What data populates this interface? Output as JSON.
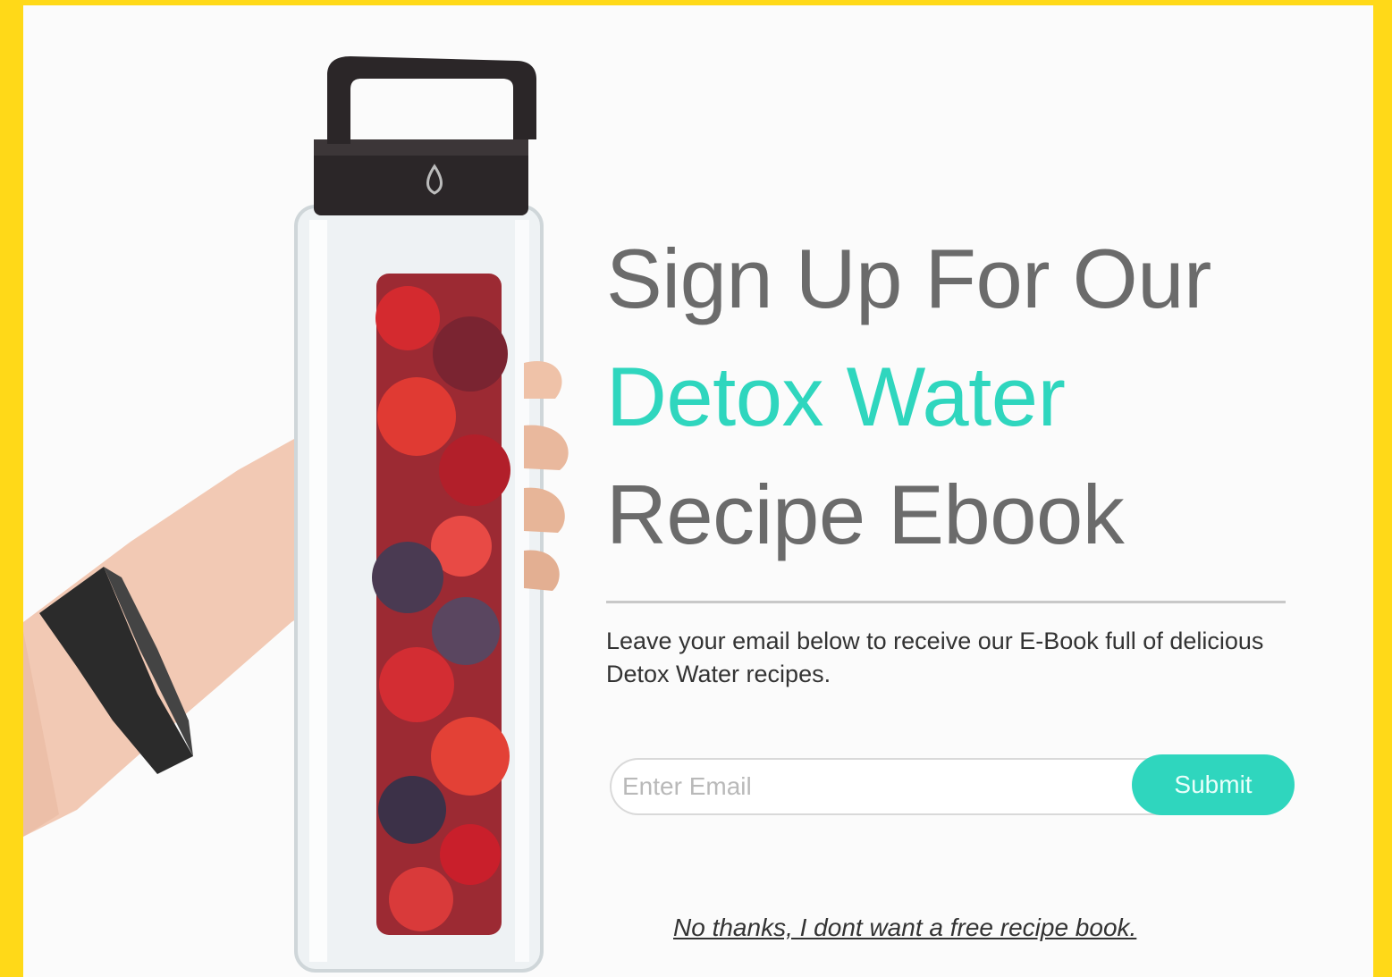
{
  "colors": {
    "frame": "#ffd918",
    "accent": "#2fd6be",
    "headline_text": "#6b6b6b",
    "background": "#fbfbfb"
  },
  "hero": {
    "image_icon": "water-bottle-illustration"
  },
  "headline": {
    "line1": "Sign Up For Our",
    "accent": "Detox Water",
    "line3": "Recipe Ebook"
  },
  "subtext": "Leave your email below to receive our E-Book full of delicious Detox Water recipes.",
  "form": {
    "email_placeholder": "Enter Email",
    "submit_label": "Submit"
  },
  "decline_label": "No thanks, I dont want a free recipe book."
}
